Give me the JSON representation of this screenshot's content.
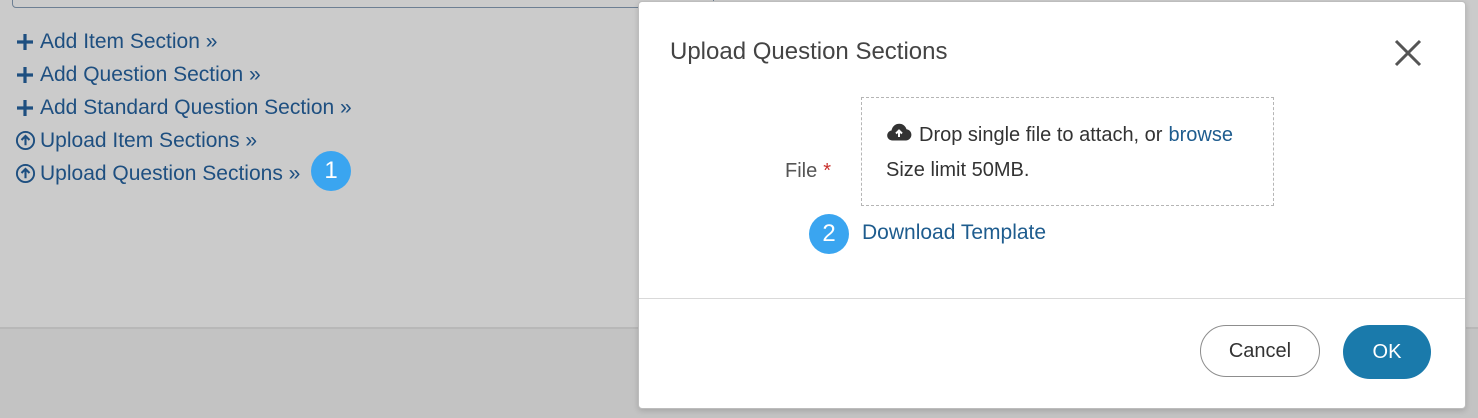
{
  "background": {
    "links": [
      {
        "icon": "plus-icon",
        "label": "Add Item Section »"
      },
      {
        "icon": "plus-icon",
        "label": "Add Question Section »"
      },
      {
        "icon": "plus-icon",
        "label": "Add Standard Question Section »"
      },
      {
        "icon": "upload-circle-icon",
        "label": "Upload Item Sections »"
      },
      {
        "icon": "upload-circle-icon",
        "label": "Upload Question Sections »"
      }
    ],
    "step_badge_1": "1"
  },
  "modal": {
    "title": "Upload Question Sections",
    "file_label": "File",
    "required_marker": "*",
    "dropzone": {
      "icon": "cloud-upload-icon",
      "text": "Drop single file to attach, or",
      "browse_label": "browse",
      "size_limit": "Size limit 50MB."
    },
    "step_badge_2": "2",
    "download_template_label": "Download Template",
    "cancel_label": "Cancel",
    "ok_label": "OK"
  },
  "colors": {
    "link": "#1e4f80",
    "badge": "#3aa5f0",
    "primary_button": "#1a7aab",
    "required": "#c9302c"
  }
}
